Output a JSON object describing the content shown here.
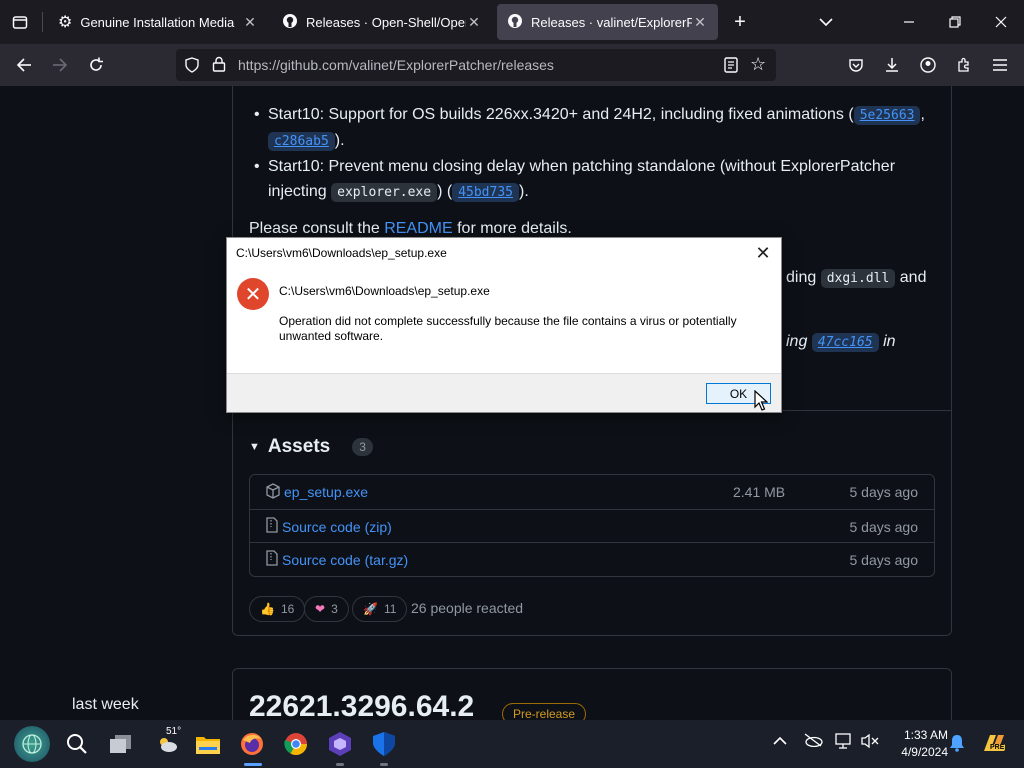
{
  "browser": {
    "tabs": [
      {
        "label": "Genuine Installation Media",
        "icon": "gear-icon",
        "active": false
      },
      {
        "label": "Releases · Open-Shell/Open-Shell-Menu",
        "icon": "github-icon",
        "active": false
      },
      {
        "label": "Releases · valinet/ExplorerPatcher",
        "icon": "github-icon",
        "active": true
      }
    ],
    "new_tab_symbol": "+",
    "url": "https://github.com/valinet/ExplorerPatcher/releases"
  },
  "release": {
    "bullets": [
      {
        "prefix": "Start10: Support for OS builds 226xx.3420+ and 24H2, including fixed animations (",
        "commits": [
          "5e25663",
          "c286ab5"
        ],
        "suffix": ")."
      },
      {
        "prefix": "Start10: Prevent menu closing delay when patching standalone (without ExplorerPatcher injecting ",
        "code": "explorer.exe",
        "mid": ") (",
        "commits": [
          "45bd735"
        ],
        "suffix": ")."
      }
    ],
    "consult_prefix": "Please consult the ",
    "consult_link": "README",
    "consult_suffix": " for more details.",
    "hidden_line1_tail": "ding",
    "hidden_line1_code": "dxgi.dll",
    "hidden_line1_end": "and",
    "hidden_line2_tail": "ing",
    "hidden_line2_commit": "47cc165",
    "hidden_line2_end": "in"
  },
  "assets": {
    "title": "Assets",
    "count": "3",
    "items": [
      {
        "name": "ep_setup.exe",
        "size": "2.41 MB",
        "date": "5 days ago",
        "icon": "package-icon"
      },
      {
        "name": "Source code",
        "ext": "(zip)",
        "size": "",
        "date": "5 days ago",
        "icon": "file-zip-icon"
      },
      {
        "name": "Source code",
        "ext": "(tar.gz)",
        "size": "",
        "date": "5 days ago",
        "icon": "file-zip-icon"
      }
    ]
  },
  "reactions": {
    "items": [
      {
        "emoji": "👍",
        "count": "16"
      },
      {
        "emoji": "❤",
        "count": "3"
      },
      {
        "emoji": "🚀",
        "count": "11"
      }
    ],
    "summary": "26 people reacted"
  },
  "next_release": {
    "date_label": "last week",
    "title": "22621.3296.64.2",
    "badge": "Pre-release"
  },
  "dialog": {
    "title": "C:\\Users\\vm6\\Downloads\\ep_setup.exe",
    "path": "C:\\Users\\vm6\\Downloads\\ep_setup.exe",
    "message": "Operation did not complete successfully because the file contains a virus or potentially unwanted software.",
    "ok_label": "OK",
    "close_symbol": "✕"
  },
  "taskbar": {
    "weather_temp": "51°",
    "time": "1:33 AM",
    "date": "4/9/2024",
    "badge": "PRE"
  }
}
